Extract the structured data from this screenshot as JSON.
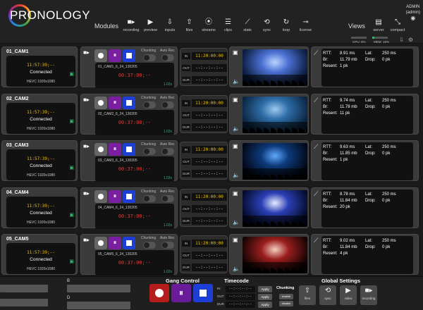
{
  "header": {
    "logo_text": "PRONOLOGY",
    "modules_label": "Modules",
    "views_label": "Views",
    "modules": [
      {
        "label": "recording",
        "icon": "camera-icon"
      },
      {
        "label": "preview",
        "icon": "play-icon"
      },
      {
        "label": "inputs",
        "icon": "download-icon"
      },
      {
        "label": "files",
        "icon": "upload-icon"
      },
      {
        "label": "streams",
        "icon": "broadcast-icon"
      },
      {
        "label": "clips",
        "icon": "list-icon"
      },
      {
        "label": "stats",
        "icon": "stats-icon"
      },
      {
        "label": "sync",
        "icon": "sync-icon"
      },
      {
        "label": "loop",
        "icon": "loop-icon"
      },
      {
        "label": "license",
        "icon": "key-icon"
      }
    ],
    "views": [
      {
        "label": "server",
        "icon": "server-icon"
      },
      {
        "label": "compact",
        "icon": "compact-icon"
      }
    ],
    "user": {
      "name": "ADMIN",
      "role": "(admin)"
    },
    "cpu": {
      "label": "CPU: 0%",
      "value": 0
    },
    "mem": {
      "label": "MEM: 15%",
      "value": 15
    }
  },
  "timecode_labels": {
    "in": "IN",
    "out": "OUT",
    "dur": "DUR"
  },
  "rec_labels": {
    "chunking": "Chunking",
    "auto_rec": "Auto Rec"
  },
  "stats_labels": {
    "rtt": "RTT:",
    "br": "Br:",
    "resent": "Resent:",
    "lat": "Lat:",
    "drop": "Drop:"
  },
  "cameras": [
    {
      "name": "01_CAM1",
      "time": "11:57:39;--",
      "status": "Connected",
      "codec": "HEVC    1920x1080",
      "file": "01_CAM1_6_24_130205",
      "duration": "00:37:00;--",
      "rate": "1.02x",
      "tc_in": "11:20:00:00",
      "tc_out": "--:--:--:--",
      "tc_dur": "--:--:--:--",
      "rtt": "8.91 ms",
      "br": "11.79 mb",
      "resent": "1 pk",
      "lat": "250 ms",
      "drop": "0 pk",
      "preview_colors": [
        "#0a1a3a",
        "#4a6fd1",
        "#b8d4ff"
      ]
    },
    {
      "name": "02_CAM2",
      "time": "11:57:39;--",
      "status": "Connected",
      "codec": "HEVC    1920x1080",
      "file": "02_CAM2_6_24_130205",
      "duration": "00:37:00;--",
      "rate": "1.02x",
      "tc_in": "11:20:00:00",
      "tc_out": "--:--:--:--",
      "tc_dur": "--:--:--:--",
      "rtt": "9.74 ms",
      "br": "11.78 mb",
      "resent": "11 pk",
      "lat": "250 ms",
      "drop": "0 pk",
      "preview_colors": [
        "#0b2540",
        "#2e6ea8",
        "#9ec8ef"
      ]
    },
    {
      "name": "03_CAM3",
      "time": "11:57:39;--",
      "status": "Connected",
      "codec": "HEVC    1920x1080",
      "file": "03_CAM3_6_24_130205",
      "duration": "00:37:00;--",
      "rate": "1.02x",
      "tc_in": "11:20:00:00",
      "tc_out": "--:--:--:--",
      "tc_dur": "--:--:--:--",
      "rtt": "9.63 ms",
      "br": "11.85 mb",
      "resent": "1 pk",
      "lat": "250 ms",
      "drop": "0 pk",
      "preview_colors": [
        "#020816",
        "#0d3a7a",
        "#5fa8ff"
      ]
    },
    {
      "name": "04_CAM4",
      "time": "11:57:39;--",
      "status": "Connected",
      "codec": "HEVC    1920x1080",
      "file": "04_CAM4_6_24_130205",
      "duration": "00:37:00;--",
      "rate": "1.02x",
      "tc_in": "11:20:00:00",
      "tc_out": "--:--:--:--",
      "tc_dur": "--:--:--:--",
      "rtt": "8.78 ms",
      "br": "11.84 mb",
      "resent": "20 pk",
      "lat": "250 ms",
      "drop": "0 pk",
      "preview_colors": [
        "#050b2a",
        "#2a3fb5",
        "#e8ecff"
      ]
    },
    {
      "name": "05_CAM5",
      "time": "11:57:39;--",
      "status": "Connected",
      "codec": "HEVC    1920x1080",
      "file": "05_CAM5_6_24_130205",
      "duration": "00:37:00;--",
      "rate": "1.02x",
      "tc_in": "11:20:00:00",
      "tc_out": "--:--:--:--",
      "tc_dur": "--:--:--:--",
      "rtt": "9.02 ms",
      "br": "11.84 mb",
      "resent": "4 pk",
      "lat": "250 ms",
      "drop": "0 pk",
      "preview_colors": [
        "#140404",
        "#9a1d1d",
        "#f3d0c0"
      ]
    }
  ],
  "footer": {
    "field_b_label": "B",
    "field_d_label": "D",
    "gang_control_title": "Gang Control",
    "timecode_title": "Timecode",
    "tc_rows": [
      {
        "label": "IN",
        "value": "--:--:--:--",
        "apply": "Apply"
      },
      {
        "label": "OUT",
        "value": "--:--:--:--",
        "apply": "Apply"
      },
      {
        "label": "DUR",
        "value": "--:--:--:--",
        "apply": "Apply"
      }
    ],
    "chunking_title": "Chunking",
    "chunking_enable": "enable",
    "chunking_disable": "disable",
    "global_settings_title": "Global Settings",
    "global_buttons": [
      {
        "label": "files",
        "icon": "upload-icon"
      },
      {
        "label": "sync",
        "icon": "sync-icon"
      },
      {
        "label": "video",
        "icon": "play-icon"
      },
      {
        "label": "recording",
        "icon": "camera-icon"
      }
    ]
  },
  "colors": {
    "accent_yellow": "#f1c40f",
    "record_red": "#e53935",
    "purple": "#7b1fa2",
    "blue": "#1e3fd6",
    "status_green": "#3cb371"
  }
}
